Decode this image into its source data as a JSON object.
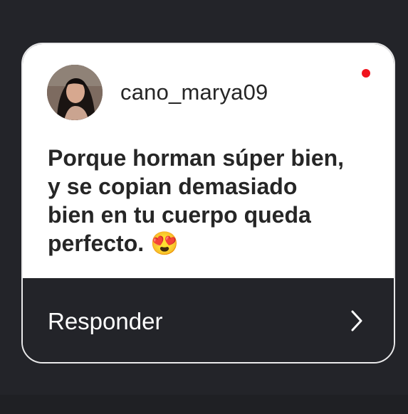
{
  "card": {
    "username": "cano_marya09",
    "message": "Porque horman súper bien,\ny se copian demasiado\nbien en tu cuerpo queda\nperfecto. 😍",
    "reply_label": "Responder",
    "unread_color": "#f0141e"
  },
  "icons": {
    "avatar": "profile-photo",
    "reply": "chevron-right-icon",
    "unread": "unread-dot-icon"
  }
}
